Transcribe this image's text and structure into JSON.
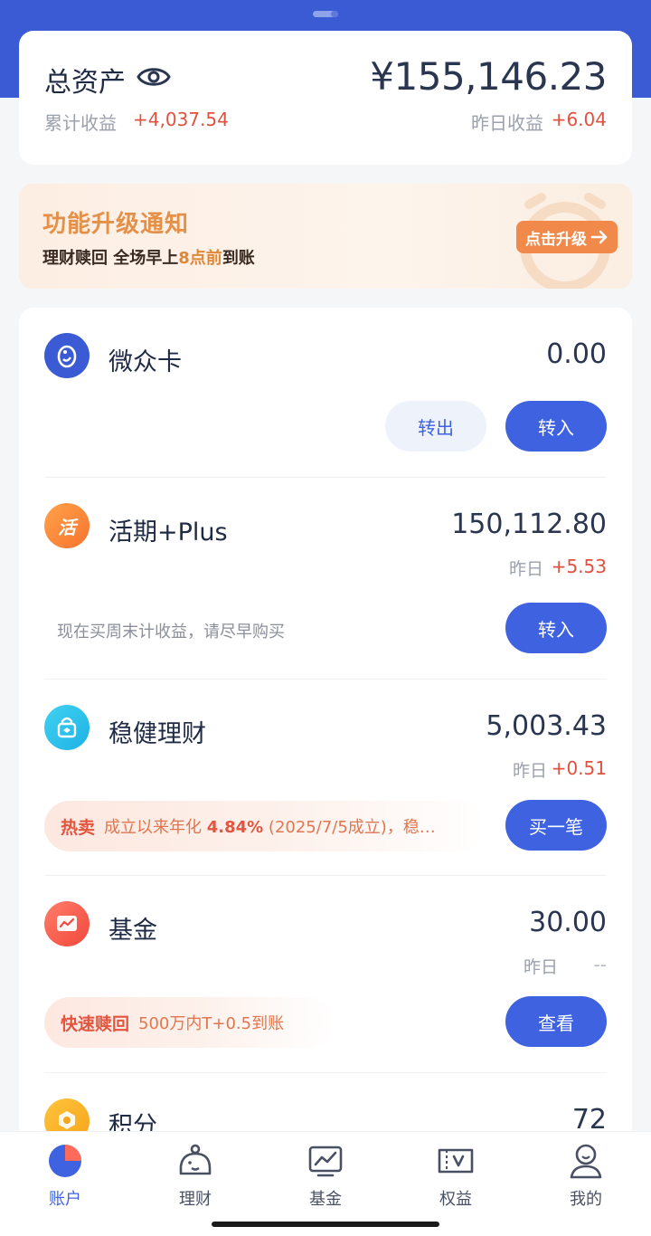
{
  "summary": {
    "title": "总资产",
    "total": "¥155,146.23",
    "cumulative_label": "累计收益",
    "cumulative_value": "+4,037.54",
    "yesterday_label": "昨日收益",
    "yesterday_value": "+6.04"
  },
  "banner": {
    "title": "功能升级通知",
    "sub_prefix": "理财赎回 全场早上",
    "sub_highlight": "8点前",
    "sub_suffix": "到账",
    "button": "点击升级"
  },
  "accounts": [
    {
      "name": "微众卡",
      "amount": "0.00",
      "btn_out": "转出",
      "btn_in": "转入",
      "icon": "penguin-icon"
    },
    {
      "name": "活期+Plus",
      "amount": "150,112.80",
      "yest_label": "昨日",
      "yest_value": "+5.53",
      "hint": "现在买周末计收益，请尽早购买",
      "btn": "转入",
      "icon": "huo-icon",
      "icon_text": "活"
    },
    {
      "name": "稳健理财",
      "amount": "5,003.43",
      "yest_label": "昨日",
      "yest_value": "+0.51",
      "tag": "热卖",
      "tag_pre": "成立以来年化 ",
      "tag_rate": "4.84%",
      "tag_post": " (2025/7/5成立)，稳…",
      "btn": "买一笔",
      "icon": "lock-bag-icon"
    },
    {
      "name": "基金",
      "amount": "30.00",
      "yest_label": "昨日",
      "yest_value": "--",
      "tag": "快速赎回",
      "tag_text": "500万内T+0.5到账",
      "btn": "查看",
      "icon": "chart-icon"
    },
    {
      "name": "积分",
      "amount": "72",
      "icon": "medal-icon"
    }
  ],
  "tabs": [
    {
      "label": "账户",
      "icon": "pie-chart-icon",
      "active": true
    },
    {
      "label": "理财",
      "icon": "piggy-icon"
    },
    {
      "label": "基金",
      "icon": "line-chart-icon"
    },
    {
      "label": "权益",
      "icon": "ticket-icon"
    },
    {
      "label": "我的",
      "icon": "user-icon"
    }
  ],
  "colors": {
    "primary": "#3f63e0",
    "header": "#3b5bd4",
    "gain": "#e0513f",
    "banner_accent": "#f0894a"
  }
}
